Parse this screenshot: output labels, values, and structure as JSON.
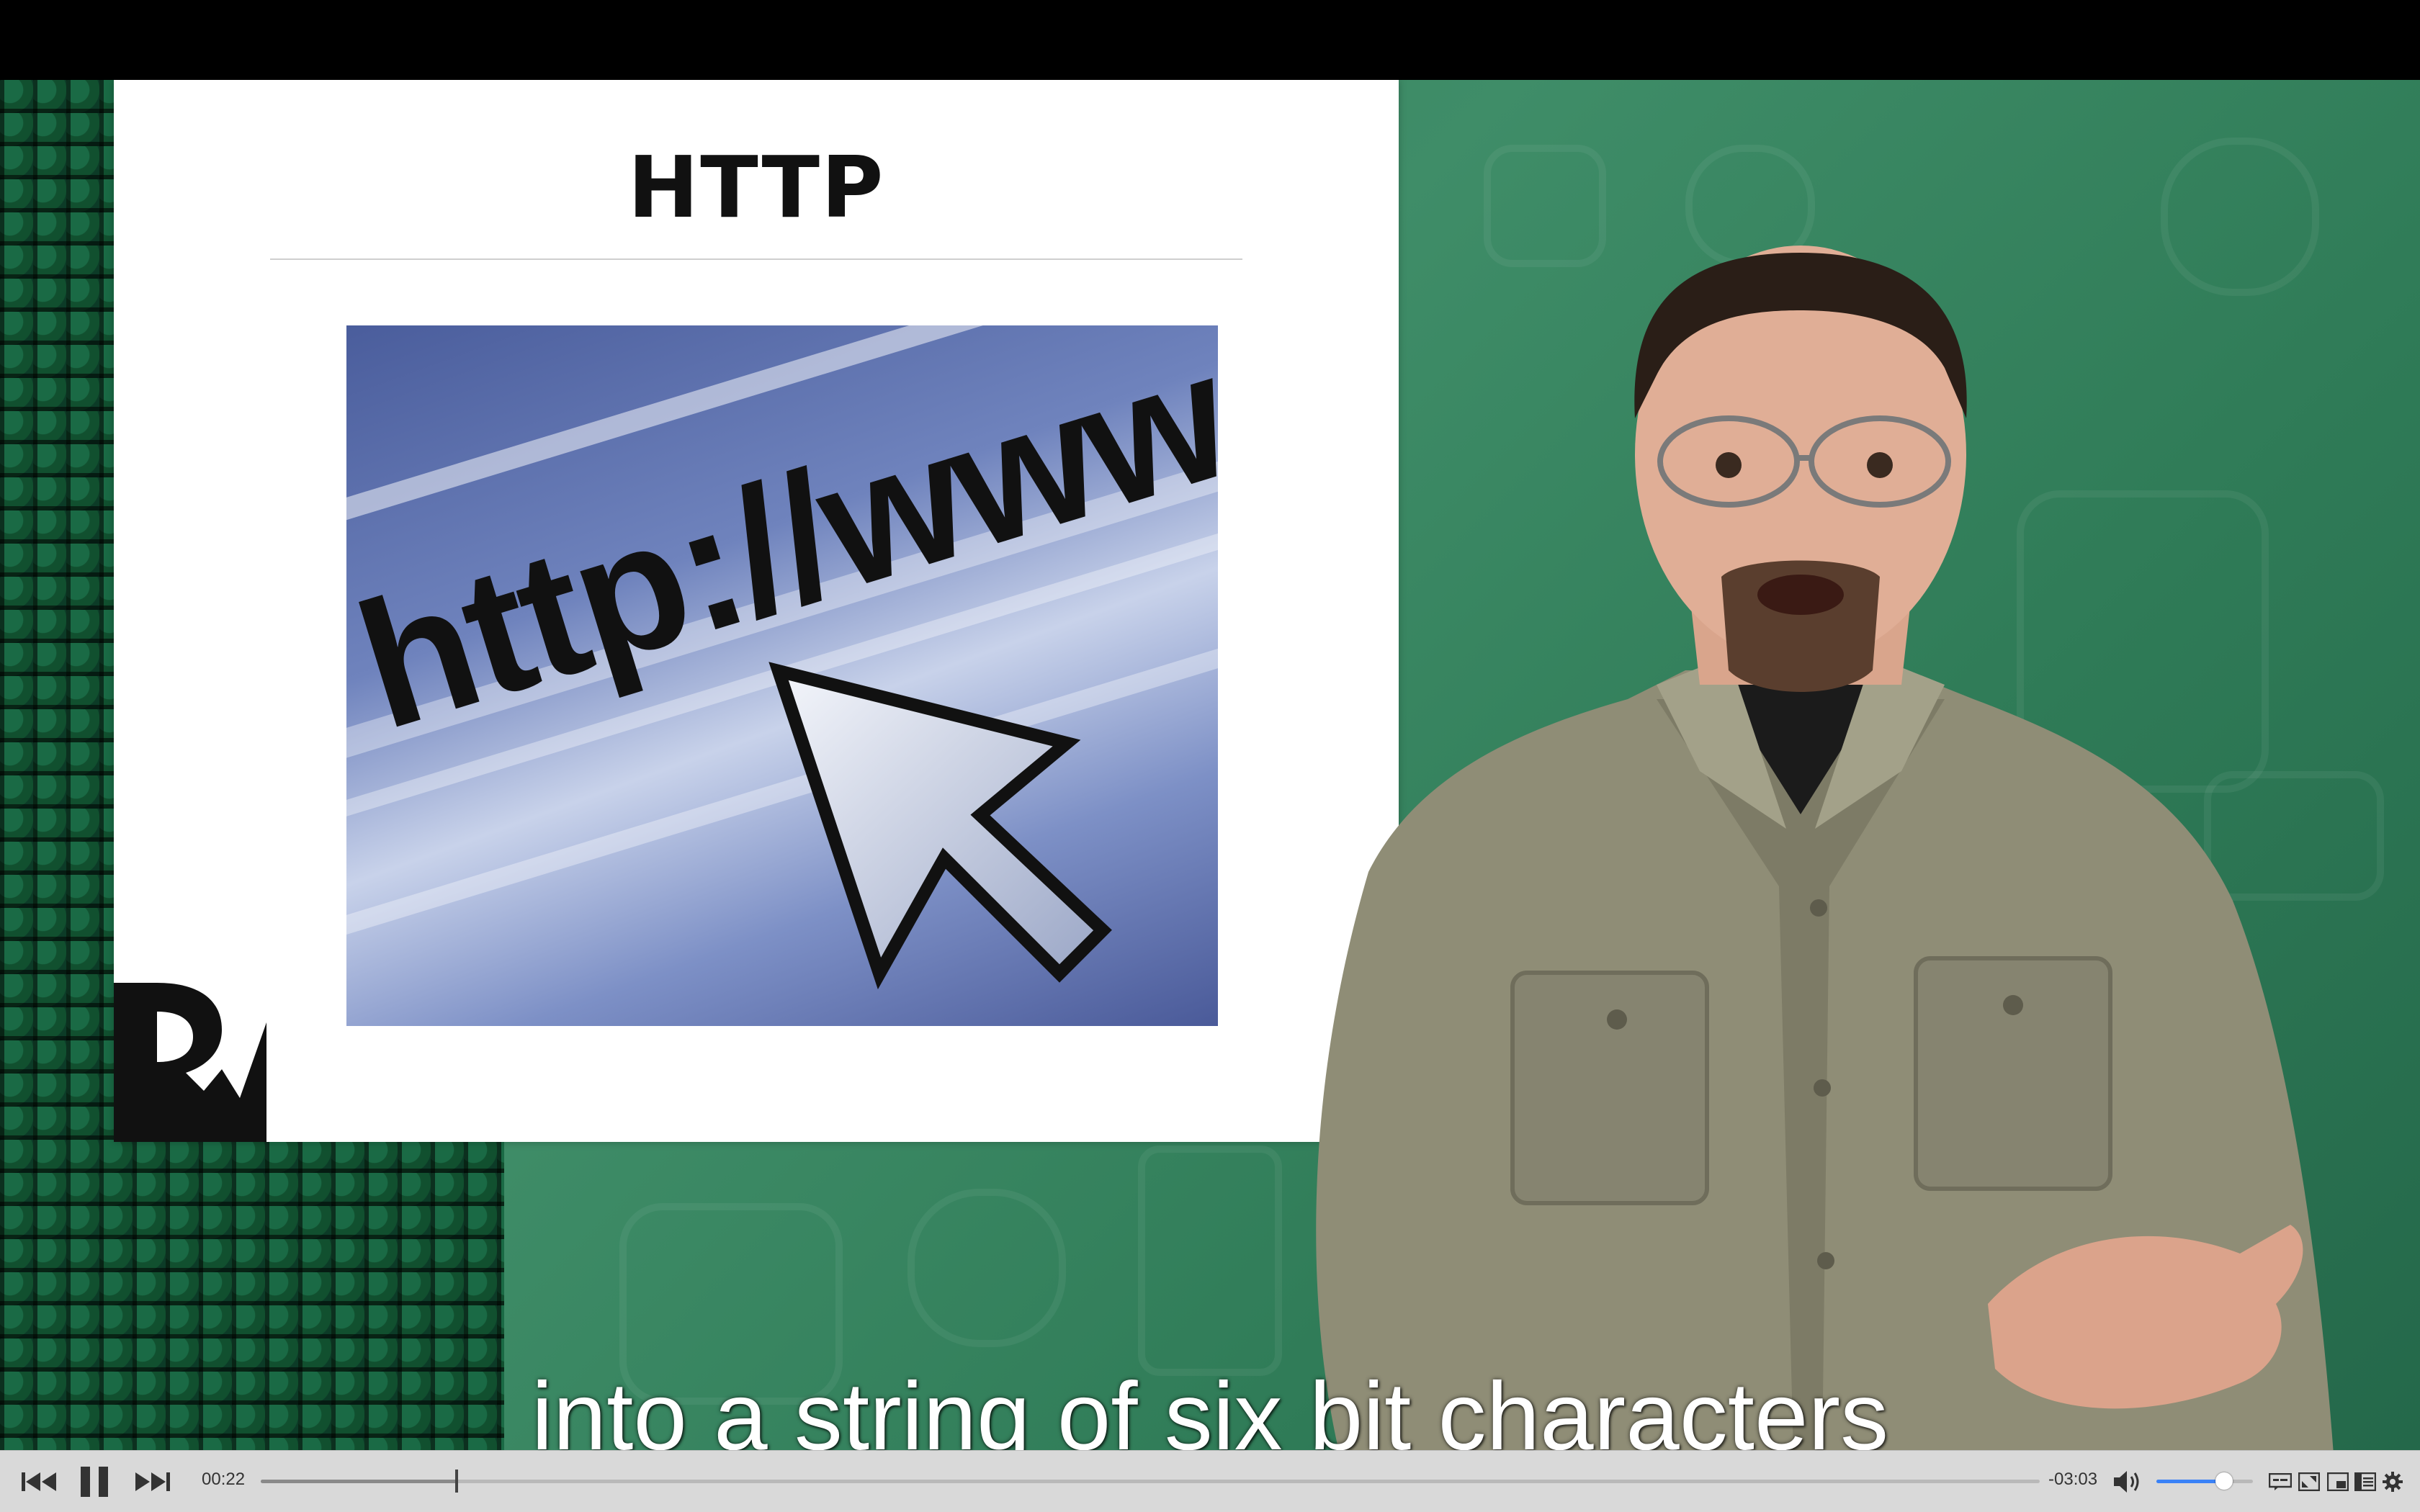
{
  "slide": {
    "title": "HTTP",
    "image_text": "http://www"
  },
  "subtitle": "into a string of six bit characters",
  "player": {
    "elapsed": "00:22",
    "remaining": "-03:03",
    "progress_fraction": 0.11,
    "volume_fraction": 0.7,
    "controls": {
      "previous": "previous-track-icon",
      "pause": "pause-icon",
      "next": "next-track-icon",
      "volume": "speaker-icon",
      "captions": "captions-icon",
      "fullscreen": "fullscreen-icon",
      "pip": "picture-in-picture-icon",
      "chapters": "chapters-icon",
      "settings": "gear-icon"
    }
  },
  "colors": {
    "background_green": "#3f8d68",
    "control_bar": "#d9d9d9",
    "volume_accent": "#3a82f7"
  }
}
